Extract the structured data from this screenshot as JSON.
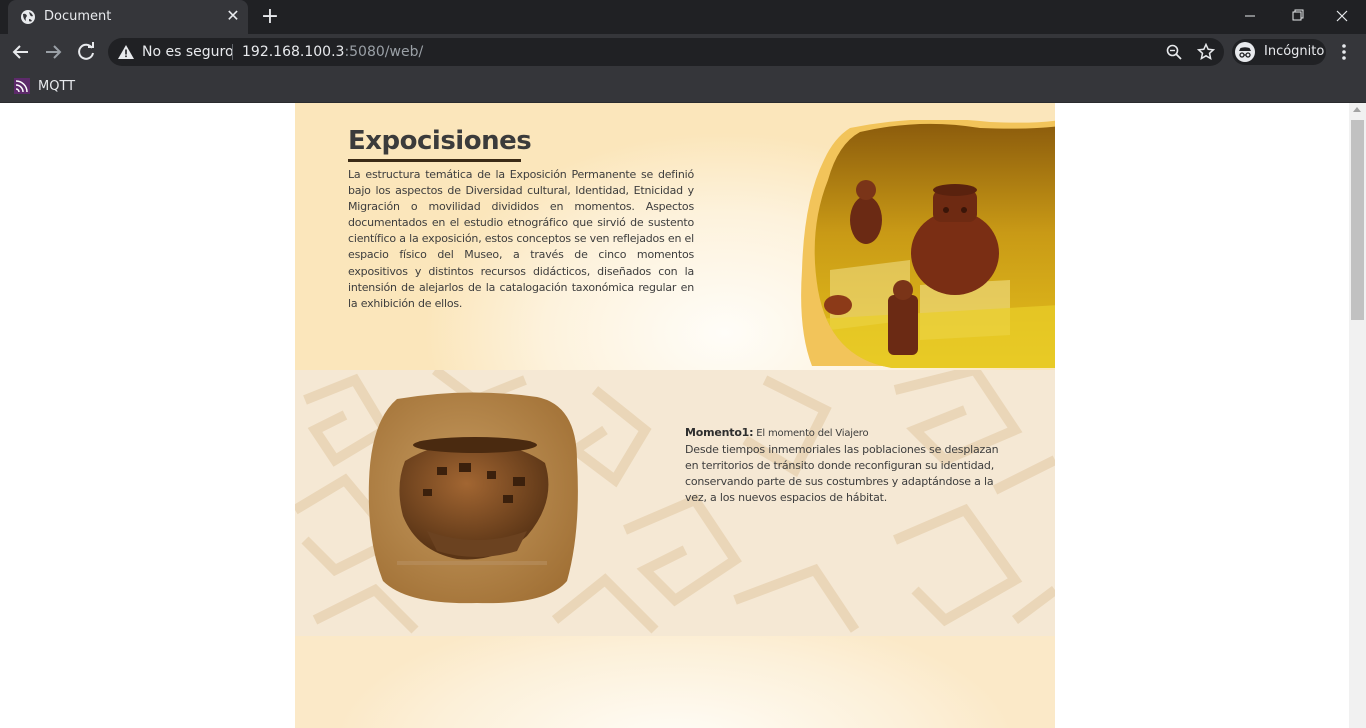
{
  "browser": {
    "tab_title": "Document",
    "security_label": "No es seguro",
    "url_host": "192.168.100.3",
    "url_rest": ":5080/web/",
    "profile_label": "Incógnito",
    "bookmarks": [
      {
        "label": "MQTT"
      }
    ]
  },
  "page": {
    "section1": {
      "title": "Expocisiones",
      "body": "La estructura temática de la Exposición Permanente se definió bajo los aspectos de Diversidad cultural, Identidad, Etnicidad y Migración o movilidad divididos en momentos. Aspectos documentados en el estudio etnográfico que sirvió de sustento científico a la exposición, estos conceptos se ven reflejados en el espacio físico del Museo, a través de cinco momentos expositivos y distintos recursos didácticos, diseñados con la intensión de alejarlos de la catalogación taxonómica regular en la exhibición de ellos."
    },
    "section2": {
      "moment_label": "Momento1:",
      "moment_title": " El momento del Viajero",
      "moment_body": "Desde tiempos inmemoriales las poblaciones se desplazan en territorios de tránsito donde reconfiguran su identidad, conservando parte de sus costumbres y adaptándose a la vez, a los nuevos espacios de hábitat."
    }
  },
  "colors": {
    "chrome_dark": "#202124",
    "chrome_toolbar": "#35363a",
    "accent_gold": "#f2c45a",
    "title_underline": "#3b2a15",
    "section2_bg": "#f5e8d4"
  }
}
